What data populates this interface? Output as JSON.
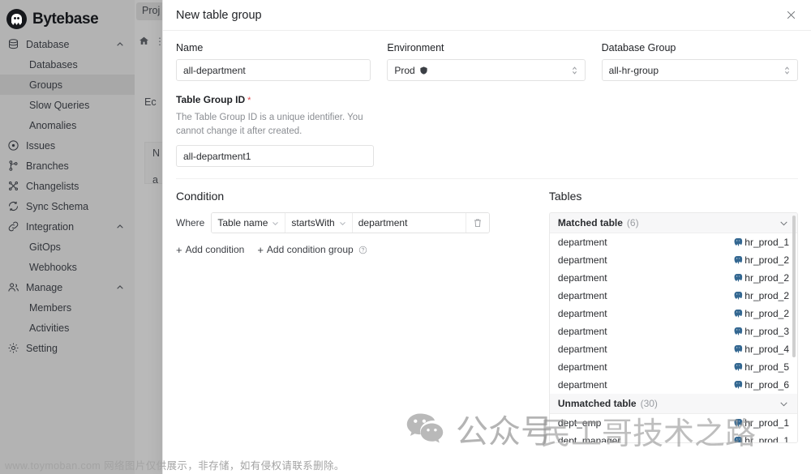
{
  "app": {
    "brand": "Bytebase",
    "sidebar": [
      {
        "label": "Database",
        "icon": "database-icon",
        "level": 0,
        "caret": "chevron-up-icon",
        "active": false
      },
      {
        "label": "Databases",
        "icon": "",
        "level": 1,
        "caret": "",
        "active": false
      },
      {
        "label": "Groups",
        "icon": "",
        "level": 1,
        "caret": "",
        "active": true
      },
      {
        "label": "Slow Queries",
        "icon": "",
        "level": 1,
        "caret": "",
        "active": false
      },
      {
        "label": "Anomalies",
        "icon": "",
        "level": 1,
        "caret": "",
        "active": false
      },
      {
        "label": "Issues",
        "icon": "circle-dot-icon",
        "level": 0,
        "caret": "",
        "active": false
      },
      {
        "label": "Branches",
        "icon": "branch-icon",
        "level": 0,
        "caret": "",
        "active": false
      },
      {
        "label": "Changelists",
        "icon": "shuffle-icon",
        "level": 0,
        "caret": "",
        "active": false
      },
      {
        "label": "Sync Schema",
        "icon": "sync-icon",
        "level": 0,
        "caret": "",
        "active": false
      },
      {
        "label": "Integration",
        "icon": "link-icon",
        "level": 0,
        "caret": "chevron-up-icon",
        "active": false
      },
      {
        "label": "GitOps",
        "icon": "",
        "level": 1,
        "caret": "",
        "active": false
      },
      {
        "label": "Webhooks",
        "icon": "",
        "level": 1,
        "caret": "",
        "active": false
      },
      {
        "label": "Manage",
        "icon": "people-icon",
        "level": 0,
        "caret": "chevron-up-icon",
        "active": false
      },
      {
        "label": "Members",
        "icon": "",
        "level": 1,
        "caret": "",
        "active": false
      },
      {
        "label": "Activities",
        "icon": "",
        "level": 1,
        "caret": "",
        "active": false
      },
      {
        "label": "Setting",
        "icon": "gear-icon",
        "level": 0,
        "caret": "",
        "active": false
      }
    ],
    "project_tab": "Proj",
    "crumb_dots": "⋮",
    "ghost_ec": "Ec",
    "ghost_n": "N",
    "ghost_a": "a"
  },
  "modal": {
    "title": "New table group",
    "close_icon": "close-icon",
    "name": {
      "label": "Name",
      "value": "all-department",
      "placeholder": "Name"
    },
    "environment": {
      "label": "Environment",
      "value": "Prod",
      "badge_icon": "shield-icon",
      "stepper_icon": "updown-chevrons-icon"
    },
    "database_group": {
      "label": "Database Group",
      "value": "all-hr-group",
      "stepper_icon": "updown-chevrons-icon"
    },
    "table_group_id": {
      "label": "Table Group ID",
      "required_mark": "*",
      "help": "The Table Group ID is a unique identifier. You cannot change it after created.",
      "value": "all-department1",
      "placeholder": "Table Group ID"
    },
    "condition": {
      "title": "Condition",
      "where_label": "Where",
      "field": "Table name",
      "operator": "startsWith",
      "value": "department",
      "delete_icon": "trash-icon",
      "add_condition": "Add condition",
      "add_condition_group": "Add condition group",
      "help_icon": "question-circle-icon"
    },
    "tables": {
      "title": "Tables",
      "groups": [
        {
          "label": "Matched table",
          "count": "(6)",
          "expanded": true,
          "rows": [
            {
              "name": "department",
              "db": "hr_prod_1",
              "icon": "postgres-icon"
            },
            {
              "name": "department",
              "db": "hr_prod_2",
              "icon": "postgres-icon"
            },
            {
              "name": "department",
              "db": "hr_prod_2",
              "icon": "postgres-icon"
            },
            {
              "name": "department",
              "db": "hr_prod_2",
              "icon": "postgres-icon"
            },
            {
              "name": "department",
              "db": "hr_prod_2",
              "icon": "postgres-icon"
            },
            {
              "name": "department",
              "db": "hr_prod_3",
              "icon": "postgres-icon"
            },
            {
              "name": "department",
              "db": "hr_prod_4",
              "icon": "postgres-icon"
            },
            {
              "name": "department",
              "db": "hr_prod_5",
              "icon": "postgres-icon"
            },
            {
              "name": "department",
              "db": "hr_prod_6",
              "icon": "postgres-icon"
            }
          ]
        },
        {
          "label": "Unmatched table",
          "count": "(30)",
          "expanded": true,
          "rows": [
            {
              "name": "dept_emp",
              "db": "hr_prod_1",
              "icon": "postgres-icon"
            },
            {
              "name": "dept_manager",
              "db": "hr_prod_1",
              "icon": "postgres-icon"
            }
          ]
        }
      ]
    }
  },
  "watermarks": {
    "center_text": "公众号",
    "center_icon": "wechat-icon",
    "right_text": "民工哥技术之路",
    "bottom_text": "www.toymoban.com 网络图片仅供展示，非存储，如有侵权请联系删除。"
  }
}
